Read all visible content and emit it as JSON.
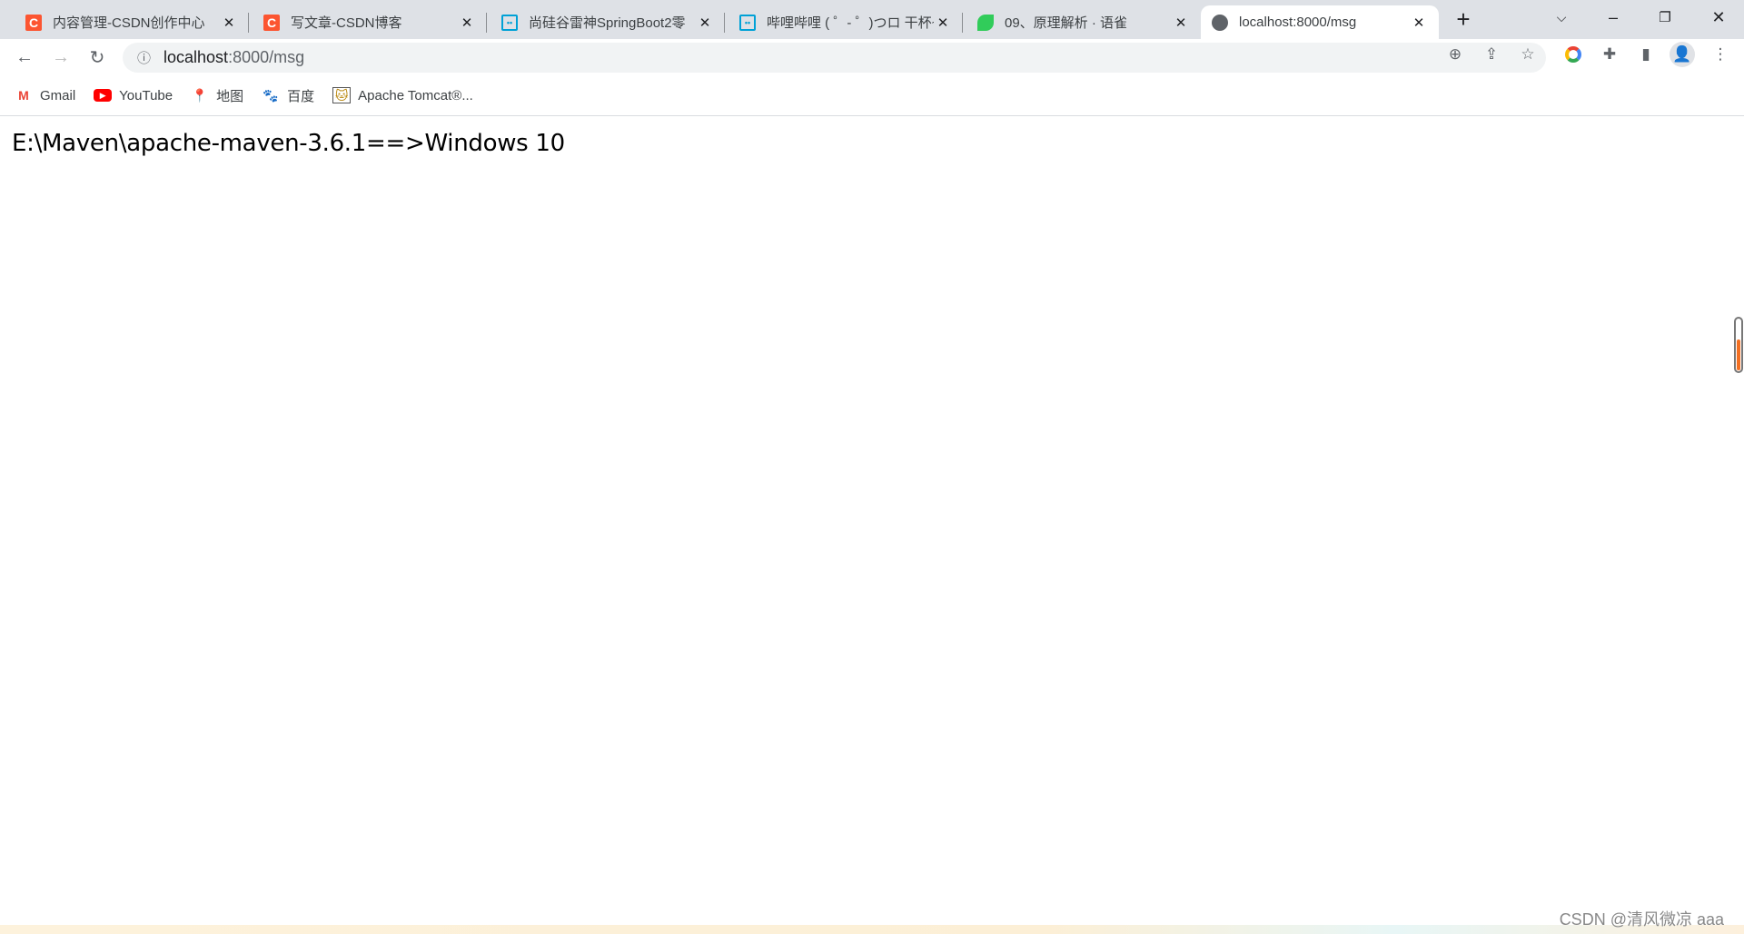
{
  "tabs": [
    {
      "title": "内容管理-CSDN创作中心",
      "icon": "csdn-icon",
      "color": "#fc5531"
    },
    {
      "title": "写文章-CSDN博客",
      "icon": "csdn-icon",
      "color": "#fc5531"
    },
    {
      "title": "尚硅谷雷神SpringBoot2零",
      "icon": "bilibili-icon",
      "color": "#00a1d6"
    },
    {
      "title": "哔哩哔哩 ( ゜- ゜)つロ 干杯~",
      "icon": "bilibili-icon",
      "color": "#00a1d6"
    },
    {
      "title": "09、原理解析 · 语雀",
      "icon": "yuque-icon",
      "color": "#31cc5a"
    },
    {
      "title": "localhost:8000/msg",
      "icon": "globe-icon",
      "color": "#5f6368",
      "active": true
    }
  ],
  "address": {
    "host": "localhost",
    "path": ":8000/msg"
  },
  "bookmarks": [
    {
      "label": "Gmail",
      "icon": "gmail-icon"
    },
    {
      "label": "YouTube",
      "icon": "youtube-icon"
    },
    {
      "label": "地图",
      "icon": "maps-icon"
    },
    {
      "label": "百度",
      "icon": "baidu-icon"
    },
    {
      "label": "Apache Tomcat®...",
      "icon": "tomcat-icon"
    }
  ],
  "page": {
    "text": "E:\\Maven\\apache-maven-3.6.1==>Windows 10"
  },
  "watermark": "CSDN @清风微凉 aaa"
}
